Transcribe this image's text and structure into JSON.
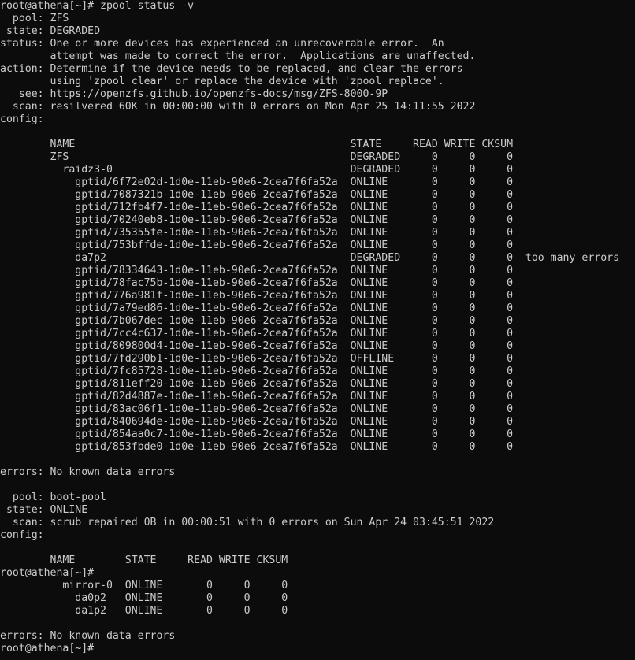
{
  "terminal": {
    "lines": [
      "root@athena[~]# zpool status -v",
      "  pool: ZFS",
      " state: DEGRADED",
      "status: One or more devices has experienced an unrecoverable error.  An",
      "        attempt was made to correct the error.  Applications are unaffected.",
      "action: Determine if the device needs to be replaced, and clear the errors",
      "        using 'zpool clear' or replace the device with 'zpool replace'.",
      "   see: https://openzfs.github.io/openzfs-docs/msg/ZFS-8000-9P",
      "  scan: resilvered 60K in 00:00:00 with 0 errors on Mon Apr 25 14:11:55 2022",
      "config:",
      "",
      "        NAME                                            STATE     READ WRITE CKSUM",
      "        ZFS                                             DEGRADED     0     0     0",
      "          raidz3-0                                      DEGRADED     0     0     0",
      "            gptid/6f72e02d-1d0e-11eb-90e6-2cea7f6fa52a  ONLINE       0     0     0",
      "            gptid/7087321b-1d0e-11eb-90e6-2cea7f6fa52a  ONLINE       0     0     0",
      "            gptid/712fb4f7-1d0e-11eb-90e6-2cea7f6fa52a  ONLINE       0     0     0",
      "            gptid/70240eb8-1d0e-11eb-90e6-2cea7f6fa52a  ONLINE       0     0     0",
      "            gptid/735355fe-1d0e-11eb-90e6-2cea7f6fa52a  ONLINE       0     0     0",
      "            gptid/753bffde-1d0e-11eb-90e6-2cea7f6fa52a  ONLINE       0     0     0",
      "            da7p2                                       DEGRADED     0     0     0  too many errors",
      "            gptid/78334643-1d0e-11eb-90e6-2cea7f6fa52a  ONLINE       0     0     0",
      "            gptid/78fac75b-1d0e-11eb-90e6-2cea7f6fa52a  ONLINE       0     0     0",
      "            gptid/776a981f-1d0e-11eb-90e6-2cea7f6fa52a  ONLINE       0     0     0",
      "            gptid/7a79ed86-1d0e-11eb-90e6-2cea7f6fa52a  ONLINE       0     0     0",
      "            gptid/7b067dec-1d0e-11eb-90e6-2cea7f6fa52a  ONLINE       0     0     0",
      "            gptid/7cc4c637-1d0e-11eb-90e6-2cea7f6fa52a  ONLINE       0     0     0",
      "            gptid/809800d4-1d0e-11eb-90e6-2cea7f6fa52a  ONLINE       0     0     0",
      "            gptid/7fd290b1-1d0e-11eb-90e6-2cea7f6fa52a  OFFLINE      0     0     0",
      "            gptid/7fc85728-1d0e-11eb-90e6-2cea7f6fa52a  ONLINE       0     0     0",
      "            gptid/811eff20-1d0e-11eb-90e6-2cea7f6fa52a  ONLINE       0     0     0",
      "            gptid/82d4887e-1d0e-11eb-90e6-2cea7f6fa52a  ONLINE       0     0     0",
      "            gptid/83ac06f1-1d0e-11eb-90e6-2cea7f6fa52a  ONLINE       0     0     0",
      "            gptid/840694de-1d0e-11eb-90e6-2cea7f6fa52a  ONLINE       0     0     0",
      "            gptid/854aa0c7-1d0e-11eb-90e6-2cea7f6fa52a  ONLINE       0     0     0",
      "            gptid/853fbde0-1d0e-11eb-90e6-2cea7f6fa52a  ONLINE       0     0     0",
      "",
      "errors: No known data errors",
      "",
      "  pool: boot-pool",
      " state: ONLINE",
      "  scan: scrub repaired 0B in 00:00:51 with 0 errors on Sun Apr 24 03:45:51 2022",
      "config:",
      "",
      "        NAME        STATE     READ WRITE CKSUM",
      "root@athena[~]#",
      "          mirror-0  ONLINE       0     0     0",
      "            da0p2   ONLINE       0     0     0",
      "            da1p2   ONLINE       0     0     0",
      "",
      "errors: No known data errors",
      "root@athena[~]#"
    ]
  },
  "colors": {
    "background": "#0c0c0c",
    "foreground": "#cccccc"
  }
}
